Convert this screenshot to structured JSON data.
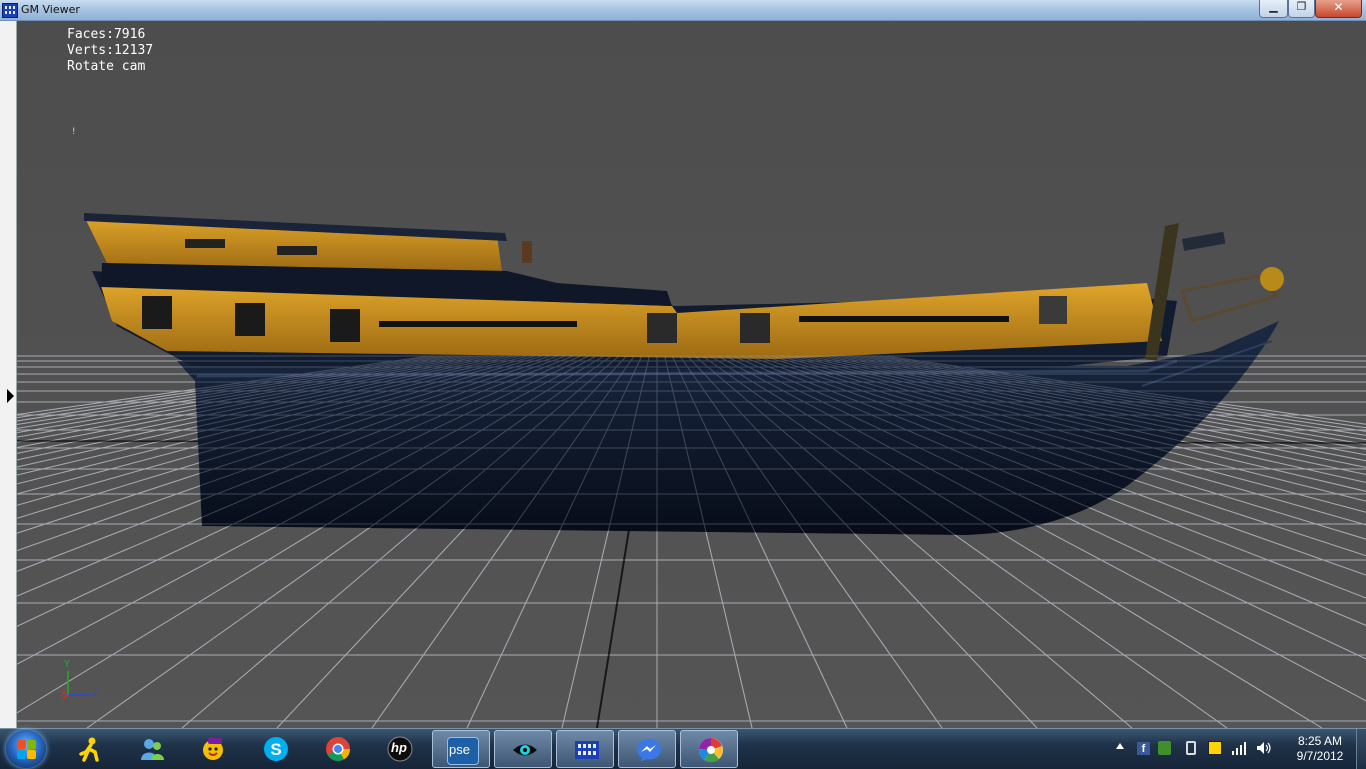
{
  "window": {
    "title": "GM Viewer",
    "minimize_glyph": "▁",
    "maximize_glyph": "❐",
    "close_glyph": "✕"
  },
  "hud": {
    "faces": "Faces:7916",
    "verts": "Verts:12137",
    "mode": "Rotate cam",
    "marker": "!"
  },
  "axis_gizmo": {
    "y": "Y",
    "x": "X",
    "z": "Z"
  },
  "colors": {
    "viewport_bg": "#4f4f4f",
    "grid": "#b4b4b4",
    "hull_dark": "#0d1526",
    "hull_stripe": "#c9921e",
    "taskbar": "#1e3249"
  },
  "taskbar": {
    "start_label": "Start",
    "items": [
      {
        "name": "aim",
        "icon": "aim-running-man-icon"
      },
      {
        "name": "windows-live-messenger",
        "icon": "messenger-people-icon"
      },
      {
        "name": "yahoo-messenger",
        "icon": "yahoo-smiley-icon"
      },
      {
        "name": "skype",
        "icon": "skype-icon"
      },
      {
        "name": "google-chrome",
        "icon": "chrome-icon"
      },
      {
        "name": "hp",
        "icon": "hp-logo-icon",
        "label": "hp"
      },
      {
        "name": "photoshop-elements",
        "icon": "pse-icon",
        "label": "pse"
      },
      {
        "name": "eye-app",
        "icon": "eye-icon"
      },
      {
        "name": "gm-viewer",
        "icon": "gm-viewer-icon"
      },
      {
        "name": "facebook-messenger",
        "icon": "chat-bubble-icon"
      },
      {
        "name": "picasa",
        "icon": "picasa-icon"
      }
    ]
  },
  "tray": {
    "icons": [
      "show-hidden-icons-arrow",
      "facebook-icon",
      "security-check-icon",
      "power-icon",
      "flag-icon",
      "signal-bars-icon",
      "volume-icon"
    ]
  },
  "clock": {
    "time": "8:25 AM",
    "date": "9/7/2012"
  }
}
